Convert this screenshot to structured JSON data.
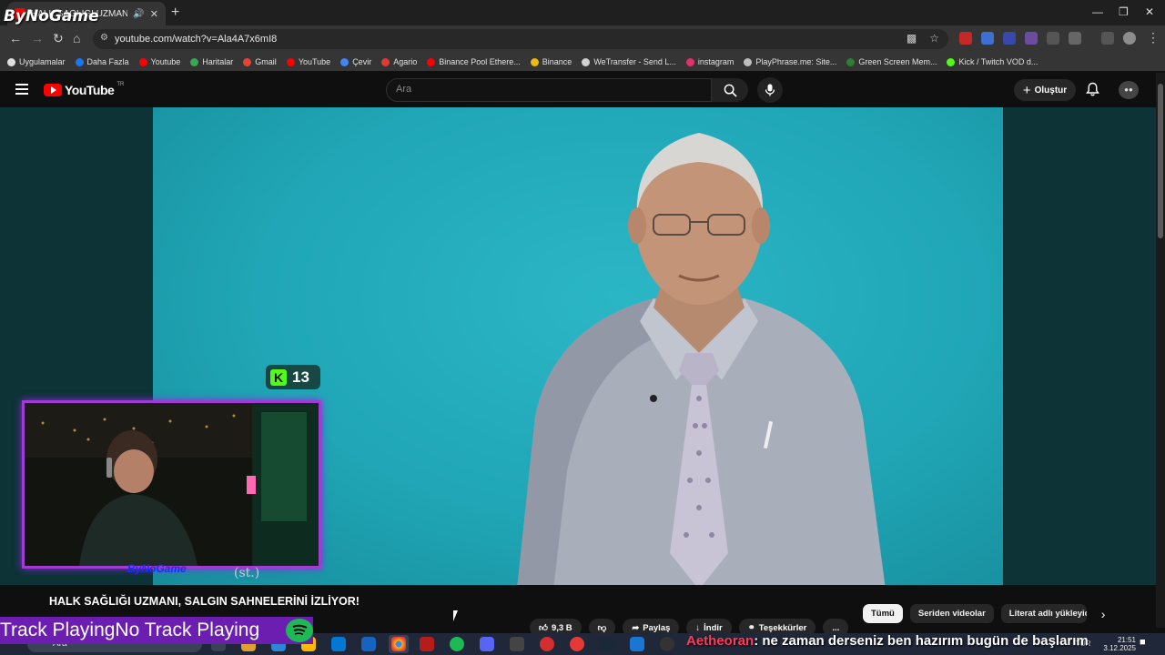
{
  "browser": {
    "tab": {
      "title": "HALK SAĞLIĞI UZMANI, SALGIN..."
    },
    "url": "youtube.com/watch?v=Ala4A7x6mI8",
    "bookmarks": [
      {
        "label": "Uygulamalar",
        "color": "#e0e0e0"
      },
      {
        "label": "Daha Fazla",
        "color": "#1877f2"
      },
      {
        "label": "Youtube",
        "color": "#ff0000"
      },
      {
        "label": "Haritalar",
        "color": "#34a853"
      },
      {
        "label": "Gmail",
        "color": "#ea4335"
      },
      {
        "label": "YouTube",
        "color": "#ff0000"
      },
      {
        "label": "Çevir",
        "color": "#4285f4"
      },
      {
        "label": "Agario",
        "color": "#e53935"
      },
      {
        "label": "Binance Pool Ethere...",
        "color": "#ff0000"
      },
      {
        "label": "Binance",
        "color": "#f0b90b"
      },
      {
        "label": "WeTransfer - Send L...",
        "color": "#d0d0d0"
      },
      {
        "label": "instagram",
        "color": "#e1306c"
      },
      {
        "label": "PlayPhrase.me: Site...",
        "color": "#bdbdbd"
      },
      {
        "label": "Green Screen Mem...",
        "color": "#2e7d32"
      },
      {
        "label": "Kick / Twitch VOD d...",
        "color": "#53fc18"
      }
    ]
  },
  "youtube": {
    "logo": "YouTube",
    "region": "TR",
    "search_placeholder": "Ara",
    "create_label": "Oluştur",
    "video_title": "HALK SAĞLIĞI UZMANI, SALGIN SAHNELERİNİ İZLİYOR!",
    "actions": {
      "likes": "9,3 B",
      "share": "Paylaş",
      "download": "İndir",
      "thanks": "Teşekkürler",
      "more": "..."
    },
    "chips": [
      "Tümü",
      "Seriden videolar",
      "Literat adlı yükleyici"
    ]
  },
  "overlay": {
    "brand": "ByNoGame",
    "kick_count": "13",
    "webcam_name": "ByNoGame",
    "webcam_tag": "(st.)",
    "now_playing": "Track PlayingNo Track Playing",
    "chat_user": "Aetheoran",
    "chat_message": ": ne zaman derseniz ben hazırım bugün de başlarım"
  },
  "taskbar": {
    "search_placeholder": "Ara",
    "lang": "TUR",
    "time": "21:51",
    "date": "3.12.2025"
  },
  "colors": {
    "youtube_red": "#ff0000",
    "kick_green": "#53fc18",
    "stream_purple": "#6b1eb0",
    "video_bg": "#20a6b6"
  }
}
